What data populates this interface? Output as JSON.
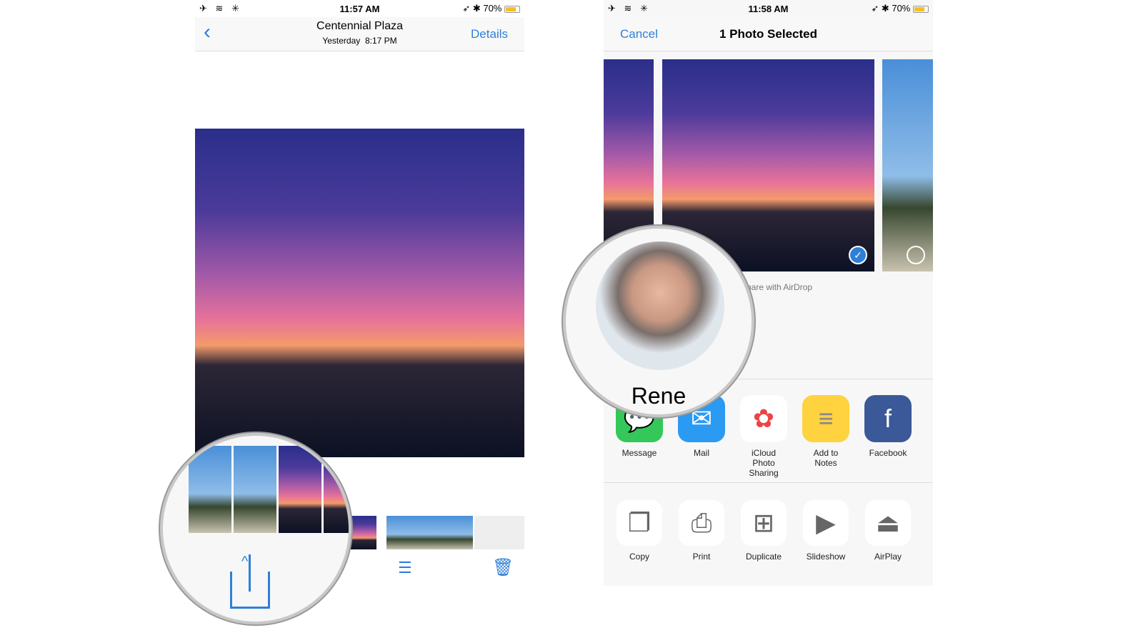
{
  "left": {
    "status": {
      "time": "11:57 AM",
      "battery": "70%",
      "battery_level": 0.7
    },
    "nav": {
      "back_icon": "chevron-left-icon",
      "title": "Centennial Plaza",
      "subtitle": "Yesterday  8:17 PM",
      "details": "Details"
    },
    "toolbar": {
      "share_icon": "share-icon",
      "edit_icon": "sliders-icon",
      "delete_icon": "trash-icon"
    }
  },
  "right": {
    "status": {
      "time": "11:58 AM",
      "battery": "70%",
      "battery_level": 0.7
    },
    "nav": {
      "cancel": "Cancel",
      "title": "1 Photo Selected"
    },
    "airdrop_hint": "Share with AirDrop",
    "airdrop_contact": "Rene",
    "share_apps": [
      {
        "label": "Message",
        "color": "#34c759"
      },
      {
        "label": "Mail",
        "color": "#2b9af3"
      },
      {
        "label": "iCloud Photo Sharing",
        "color": "#ffffff"
      },
      {
        "label": "Add to Notes",
        "color": "#ffd23f"
      },
      {
        "label": "Facebook",
        "color": "#3b5998"
      }
    ],
    "actions": [
      {
        "label": "Copy"
      },
      {
        "label": "Print"
      },
      {
        "label": "Duplicate"
      },
      {
        "label": "Slideshow"
      },
      {
        "label": "AirPlay"
      }
    ]
  }
}
